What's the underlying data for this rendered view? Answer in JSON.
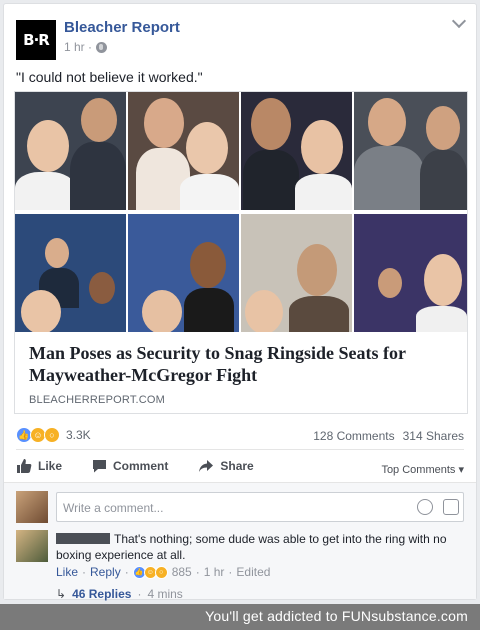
{
  "post": {
    "page_name": "Bleacher Report",
    "logo_text": "B·R",
    "time": "1 hr ·",
    "text": "\"I could not believe it worked.\""
  },
  "link": {
    "title": "Man Poses as Security to Snag Ringside Seats for Mayweather-McGregor Fight",
    "domain": "BLEACHERREPORT.COM"
  },
  "stats": {
    "reactions_count": "3.3K",
    "comments": "128 Comments",
    "shares": "314 Shares"
  },
  "actions": {
    "like": "Like",
    "comment": "Comment",
    "share": "Share",
    "top_comments": "Top Comments ▾"
  },
  "comment_box": {
    "placeholder": "Write a comment..."
  },
  "comment": {
    "text": "That's nothing; some dude was able to get into the ring with no boxing experience at all.",
    "like": "Like",
    "reply": "Reply",
    "reaction_count": "885",
    "time": "1 hr",
    "edited": "Edited",
    "replies": "46 Replies",
    "replies_time": "4 mins"
  },
  "watermark": "You'll get addicted to FUNsubstance.com",
  "colors": {
    "link_blue": "#365899",
    "like_blue": "#5890ff",
    "reaction_yellow": "#f7b125"
  }
}
